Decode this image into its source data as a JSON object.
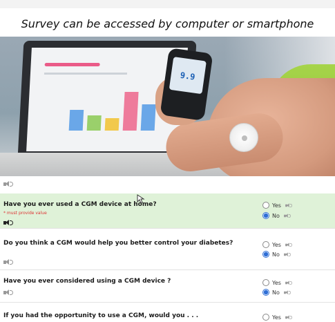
{
  "caption": "Survey can be accessed by computer or smartphone",
  "photo": {
    "reader_value": "9.9"
  },
  "questions": [
    {
      "text": "Have you ever used a CGM device at home?",
      "required_note": "* must provide value",
      "options": [
        "Yes",
        "No"
      ],
      "selected": "No",
      "highlighted": true
    },
    {
      "text": "Do you think a CGM would help you better control your diabetes?",
      "options": [
        "Yes",
        "No"
      ],
      "selected": "No"
    },
    {
      "text": "Have you ever considered using a CGM device ?",
      "options": [
        "Yes",
        "No"
      ],
      "selected": "No"
    },
    {
      "text": "If you had the opportunity to use a CGM, would you . . .",
      "options": [
        "Yes"
      ],
      "selected": null
    }
  ],
  "colors": {
    "highlight_row": "#dff2d8",
    "radio_selected": "#2f6fd6",
    "required": "#d33333"
  }
}
